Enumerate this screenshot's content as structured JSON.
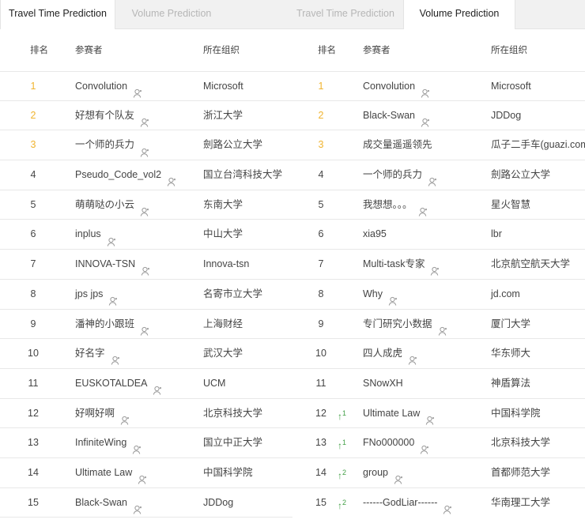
{
  "left": {
    "tabs": [
      {
        "label": "Travel Time Prediction",
        "active": true
      },
      {
        "label": "Volume Prediction",
        "active": false
      }
    ],
    "headers": {
      "rank": "排名",
      "participant": "参赛者",
      "organization": "所在组织"
    },
    "rows": [
      {
        "rank": "1",
        "name": "Convolution",
        "org": "Microsoft",
        "top": true
      },
      {
        "rank": "2",
        "name": "好想有个队友",
        "org": "浙江大学",
        "top": true
      },
      {
        "rank": "3",
        "name": "一个师的兵力",
        "org": "劍路公立大学",
        "top": true
      },
      {
        "rank": "4",
        "name": "Pseudo_Code_vol2",
        "org": "国立台湾科技大学"
      },
      {
        "rank": "5",
        "name": "萌萌哒の小云",
        "org": "东南大学"
      },
      {
        "rank": "6",
        "name": "inplus",
        "org": "中山大学"
      },
      {
        "rank": "7",
        "name": "INNOVA-TSN",
        "org": "Innova-tsn"
      },
      {
        "rank": "8",
        "name": "jps jps",
        "org": "名寄市立大学"
      },
      {
        "rank": "9",
        "name": "潘神的小跟班",
        "org": "上海财经"
      },
      {
        "rank": "10",
        "name": "好名字",
        "org": "武汉大学"
      },
      {
        "rank": "11",
        "name": "EUSKOTALDEA",
        "org": "UCM"
      },
      {
        "rank": "12",
        "name": "好啊好啊",
        "org": "北京科技大学"
      },
      {
        "rank": "13",
        "name": "InfiniteWing",
        "org": "国立中正大学"
      },
      {
        "rank": "14",
        "name": "Ultimate Law",
        "org": "中国科学院"
      },
      {
        "rank": "15",
        "name": "Black-Swan",
        "org": "JDDog"
      }
    ]
  },
  "right": {
    "tabs": [
      {
        "label": "Travel Time Prediction",
        "active": false
      },
      {
        "label": "Volume Prediction",
        "active": true
      }
    ],
    "headers": {
      "rank": "排名",
      "participant": "参赛者",
      "organization": "所在组织"
    },
    "rows": [
      {
        "rank": "1",
        "name": "Convolution",
        "org": "Microsoft",
        "top": true
      },
      {
        "rank": "2",
        "name": "Black-Swan",
        "org": "JDDog",
        "top": true
      },
      {
        "rank": "3",
        "name": "成交量遥遥领先",
        "org": "瓜子二手车(guazi.com)",
        "top": true,
        "noicon": true
      },
      {
        "rank": "4",
        "name": "一个师的兵力",
        "org": "劍路公立大学"
      },
      {
        "rank": "5",
        "name": "我想想。。。",
        "org": "星火智慧"
      },
      {
        "rank": "6",
        "name": "xia95",
        "org": "lbr",
        "noicon": true
      },
      {
        "rank": "7",
        "name": "Multi-task专家",
        "org": "北京航空航天大学"
      },
      {
        "rank": "8",
        "name": "Why",
        "org": "jd.com"
      },
      {
        "rank": "9",
        "name": "专门研究小数据",
        "org": "厦门大学"
      },
      {
        "rank": "10",
        "name": "四人成虎",
        "org": "华东师大"
      },
      {
        "rank": "11",
        "name": "SNowXH",
        "org": "神盾算法",
        "noicon": true
      },
      {
        "rank": "12",
        "name": "Ultimate Law",
        "org": "中国科学院",
        "up": "1"
      },
      {
        "rank": "13",
        "name": "FNo000000",
        "org": "北京科技大学",
        "up": "1"
      },
      {
        "rank": "14",
        "name": "group",
        "org": "首都师范大学",
        "up": "2"
      },
      {
        "rank": "15",
        "name": "------GodLiar------",
        "org": "华南理工大学",
        "up": "2"
      }
    ]
  },
  "colors": {
    "gold": "#f0b430",
    "up_arrow": "#43a047"
  }
}
